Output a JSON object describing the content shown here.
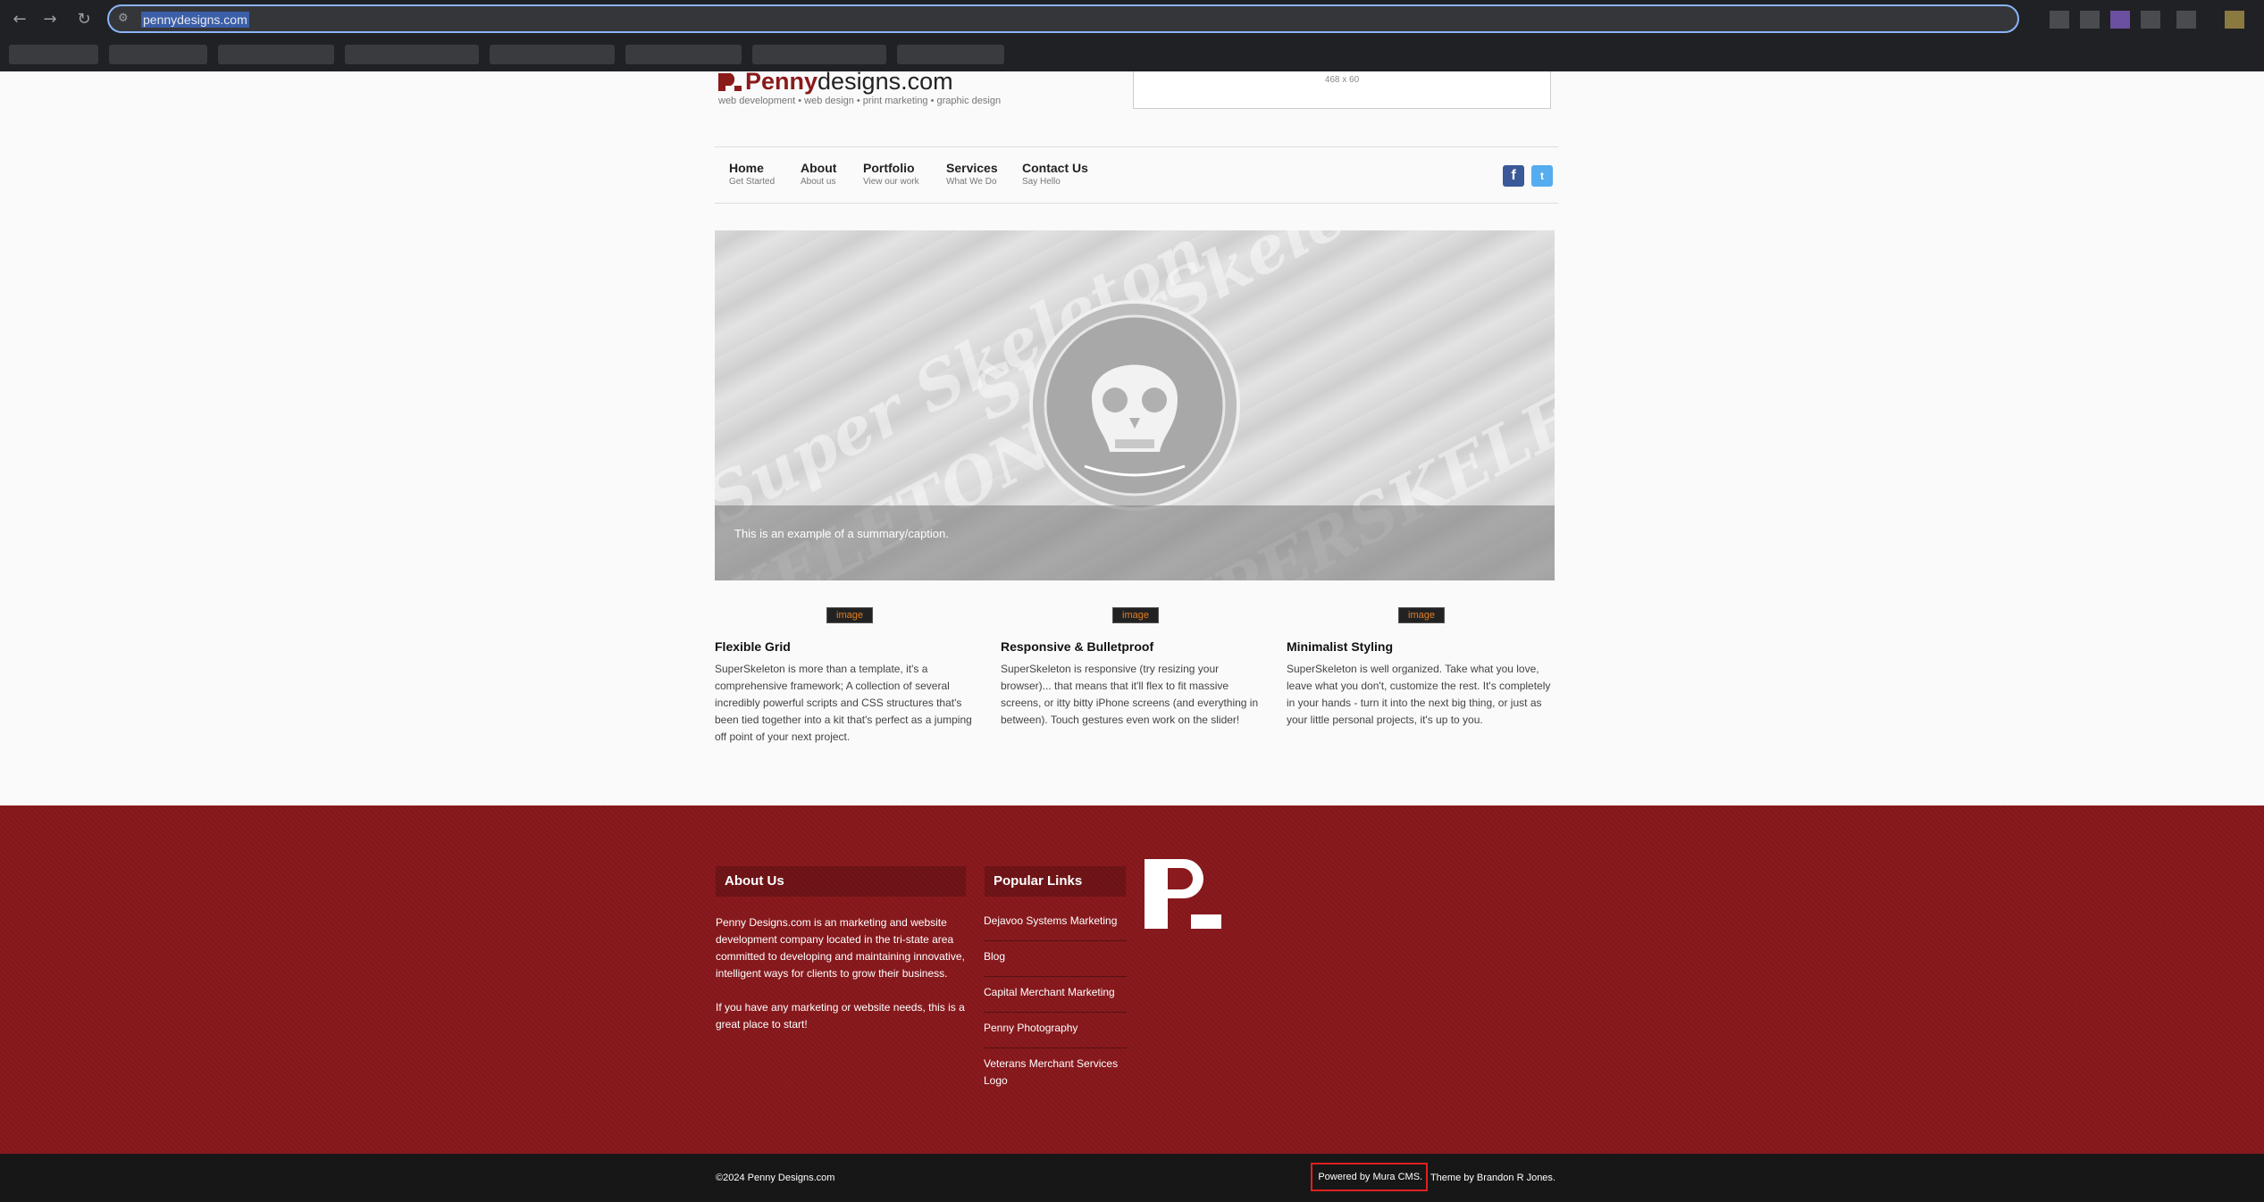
{
  "browser": {
    "back_icon": "←",
    "forward_icon": "→",
    "reload_icon": "↻",
    "site_info_icon": "⚙",
    "url": "pennydesigns.com"
  },
  "header": {
    "logo_brand": "Penny",
    "logo_suffix": "designs.com",
    "tagline": "web development • web design • print marketing • graphic design",
    "ad_size": "468 x 60"
  },
  "nav": {
    "items": [
      {
        "title": "Home",
        "sub": "Get Started"
      },
      {
        "title": "About",
        "sub": "About us"
      },
      {
        "title": "Portfolio",
        "sub": "View our work"
      },
      {
        "title": "Services",
        "sub": "What We Do"
      },
      {
        "title": "Contact Us",
        "sub": "Say Hello"
      }
    ],
    "facebook": "f",
    "twitter": "t"
  },
  "slider": {
    "caption": "This is an example of a summary/caption."
  },
  "features": [
    {
      "img_alt": "image",
      "title": "Flexible Grid",
      "text": "SuperSkeleton is more than a template, it's a comprehensive framework; A collection of several incredibly powerful scripts and CSS structures that's been tied together into a kit that's perfect as a jumping off point of your next project."
    },
    {
      "img_alt": "image",
      "title": "Responsive & Bulletproof",
      "text": "SuperSkeleton is responsive (try resizing your browser)... that means that it'll flex to fit massive screens, or itty bitty iPhone screens (and everything in between). Touch gestures even work on the slider!"
    },
    {
      "img_alt": "image",
      "title": "Minimalist Styling",
      "text": "SuperSkeleton is well organized. Take what you love, leave what you don't, customize the rest. It's completely in your hands - turn it into the next big thing, or just as your little personal projects, it's up to you."
    }
  ],
  "footer": {
    "about_heading": "About Us",
    "about_p1": "Penny Designs.com is an marketing and website development company located in the tri-state area committed to developing and maintaining innovative, intelligent ways for clients to grow their business.",
    "about_p2": "If you have any marketing or website needs, this is a great place to start!",
    "links_heading": "Popular Links",
    "links": [
      "Dejavoo Systems Marketing",
      "Blog",
      "Capital Merchant Marketing",
      "Penny Photography",
      "Veterans Merchant Services Logo"
    ]
  },
  "bottom": {
    "copyright": "©2024 Penny Designs.com",
    "powered": "Powered by Mura CMS.",
    "theme": " Theme by Brandon R Jones."
  },
  "colors": {
    "brand_red": "#8b1a1e",
    "bottom_bar": "#171717",
    "highlight_box": "#e02020"
  }
}
